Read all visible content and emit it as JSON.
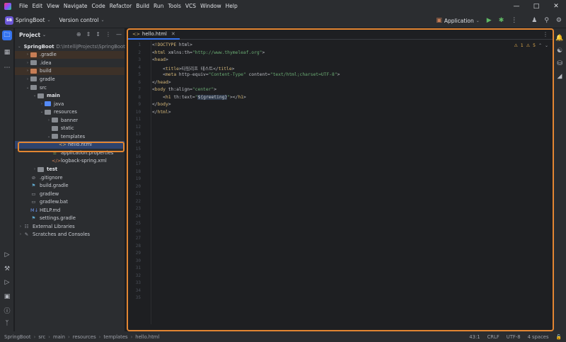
{
  "menu": [
    "File",
    "Edit",
    "View",
    "Navigate",
    "Code",
    "Refactor",
    "Build",
    "Run",
    "Tools",
    "VCS",
    "Window",
    "Help"
  ],
  "toolbar": {
    "project_badge": "SB",
    "project_name": "SpringBoot",
    "vcs_label": "Version control",
    "run_config": "Application"
  },
  "project_panel": {
    "title": "Project",
    "tree": [
      {
        "label": "SpringBoot",
        "suffix": "D:\\IntelliJProjects\\SpringBoot",
        "depth": 0,
        "arrow": "v",
        "icon": "module",
        "bold": true
      },
      {
        "label": ".gradle",
        "depth": 1,
        "arrow": ">",
        "icon": "orange",
        "excluded": true
      },
      {
        "label": ".idea",
        "depth": 1,
        "arrow": ">",
        "icon": "gray"
      },
      {
        "label": "build",
        "depth": 1,
        "arrow": ">",
        "icon": "orange",
        "excluded": true
      },
      {
        "label": "gradle",
        "depth": 1,
        "arrow": ">",
        "icon": "gray"
      },
      {
        "label": "src",
        "depth": 1,
        "arrow": "v",
        "icon": "gray"
      },
      {
        "label": "main",
        "depth": 2,
        "arrow": "v",
        "icon": "gray",
        "bold": true
      },
      {
        "label": "java",
        "depth": 3,
        "arrow": ">",
        "icon": "blue"
      },
      {
        "label": "resources",
        "depth": 3,
        "arrow": "v",
        "icon": "gray"
      },
      {
        "label": "banner",
        "depth": 4,
        "arrow": ">",
        "icon": "gray"
      },
      {
        "label": "static",
        "depth": 4,
        "arrow": "",
        "icon": "gray"
      },
      {
        "label": "templates",
        "depth": 4,
        "arrow": "v",
        "icon": "gray"
      },
      {
        "label": "hello.html",
        "depth": 5,
        "arrow": "",
        "icon": "html",
        "selected": true
      },
      {
        "label": "application.properties",
        "depth": 4,
        "arrow": "",
        "icon": "props"
      },
      {
        "label": "logback-spring.xml",
        "depth": 4,
        "arrow": "",
        "icon": "xml"
      },
      {
        "label": "test",
        "depth": 2,
        "arrow": ">",
        "icon": "gray",
        "bold": true
      },
      {
        "label": ".gitignore",
        "depth": 1,
        "arrow": "",
        "icon": "ignore"
      },
      {
        "label": "build.gradle",
        "depth": 1,
        "arrow": "",
        "icon": "gradle"
      },
      {
        "label": "gradlew",
        "depth": 1,
        "arrow": "",
        "icon": "file"
      },
      {
        "label": "gradlew.bat",
        "depth": 1,
        "arrow": "",
        "icon": "file"
      },
      {
        "label": "HELP.md",
        "depth": 1,
        "arrow": "",
        "icon": "md"
      },
      {
        "label": "settings.gradle",
        "depth": 1,
        "arrow": "",
        "icon": "gradle"
      },
      {
        "label": "External Libraries",
        "depth": 0,
        "arrow": ">",
        "icon": "lib"
      },
      {
        "label": "Scratches and Consoles",
        "depth": 0,
        "arrow": ">",
        "icon": "scratch"
      }
    ]
  },
  "editor": {
    "tab_label": "hello.html",
    "warnings": "1",
    "weak_warnings": "5",
    "line_count": 35,
    "lines": [
      "<!DOCTYPE html>",
      "<html xmlns:th=\"http://www.thymeleaf.org\">",
      "<head>",
      "    <title>타임리프 테스트</title>",
      "    <meta http-equiv=\"Content-Type\" content=\"text/html;charset=UTF-8\">",
      "</head>",
      "<body th:align=\"center\">",
      "    <h1 th:text=\"${greeting}\"></h1>",
      "</body>",
      "</html>"
    ]
  },
  "statusbar": {
    "breadcrumb": [
      "SpringBoot",
      "src",
      "main",
      "resources",
      "templates",
      "hello.html"
    ],
    "position": "43:1",
    "line_sep": "CRLF",
    "encoding": "UTF-8",
    "indent": "4 spaces"
  }
}
